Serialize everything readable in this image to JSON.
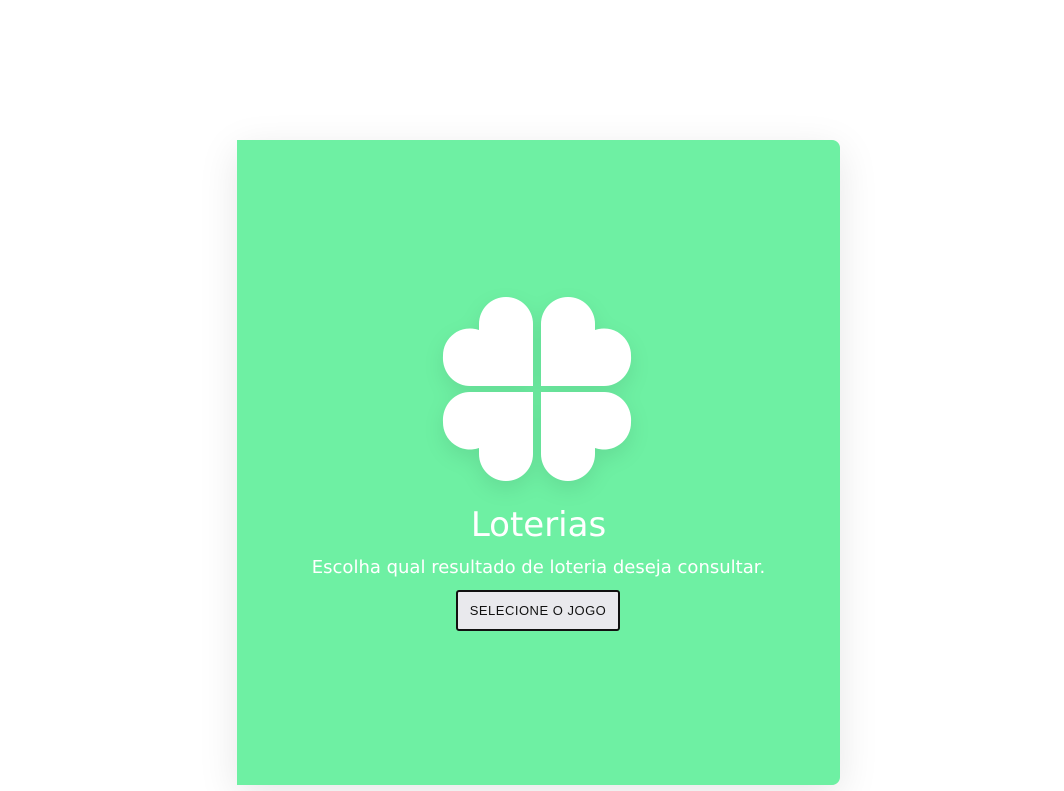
{
  "hero": {
    "title": "Loterias",
    "subtitle": "Escolha qual resultado de loteria deseja consultar.",
    "button_label": "SELECIONE O JOGO",
    "logo_icon": "four-leaf-clover-icon"
  },
  "colors": {
    "card_background": "#6ef0a3",
    "text": "#ffffff",
    "button_background": "#e9e9ed",
    "button_border": "#111111"
  }
}
